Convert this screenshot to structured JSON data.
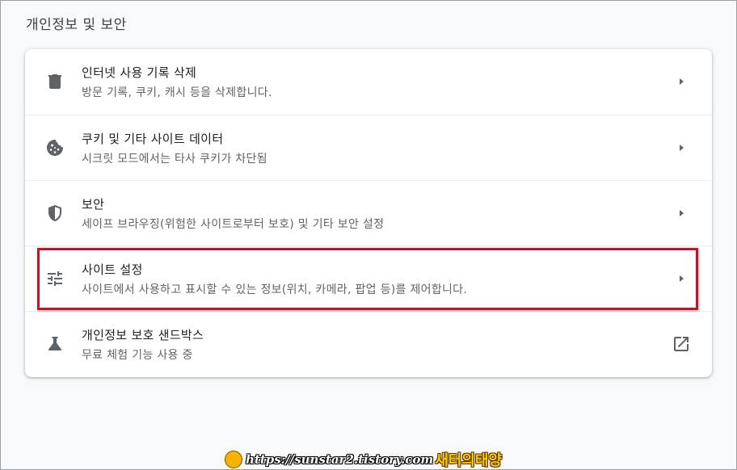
{
  "section": {
    "title": "개인정보 및 보안"
  },
  "rows": [
    {
      "label": "인터넷 사용 기록 삭제",
      "sublabel": "방문 기록, 쿠키, 캐시 등을 삭제합니다.",
      "icon": "trash-icon"
    },
    {
      "label": "쿠키 및 기타 사이트 데이터",
      "sublabel": "시크릿 모드에서는 타사 쿠키가 차단됨",
      "icon": "cookie-icon"
    },
    {
      "label": "보안",
      "sublabel": "세이프 브라우징(위험한 사이트로부터 보호) 및 기타 보안 설정",
      "icon": "shield-icon"
    },
    {
      "label": "사이트 설정",
      "sublabel": "사이트에서 사용하고 표시할 수 있는 정보(위치, 카메라, 팝업 등)를 제어합니다.",
      "icon": "tune-icon"
    },
    {
      "label": "개인정보 보호 샌드박스",
      "sublabel": "무료 체험 기능 사용 중",
      "icon": "flask-icon"
    }
  ],
  "watermark": {
    "url": "https://sunstar2.tistory.com",
    "brand": "새터의태양"
  },
  "colors": {
    "highlight": "#c8102e",
    "icon": "#5f6368",
    "primary_text": "#202124",
    "secondary_text": "#5f6368"
  }
}
